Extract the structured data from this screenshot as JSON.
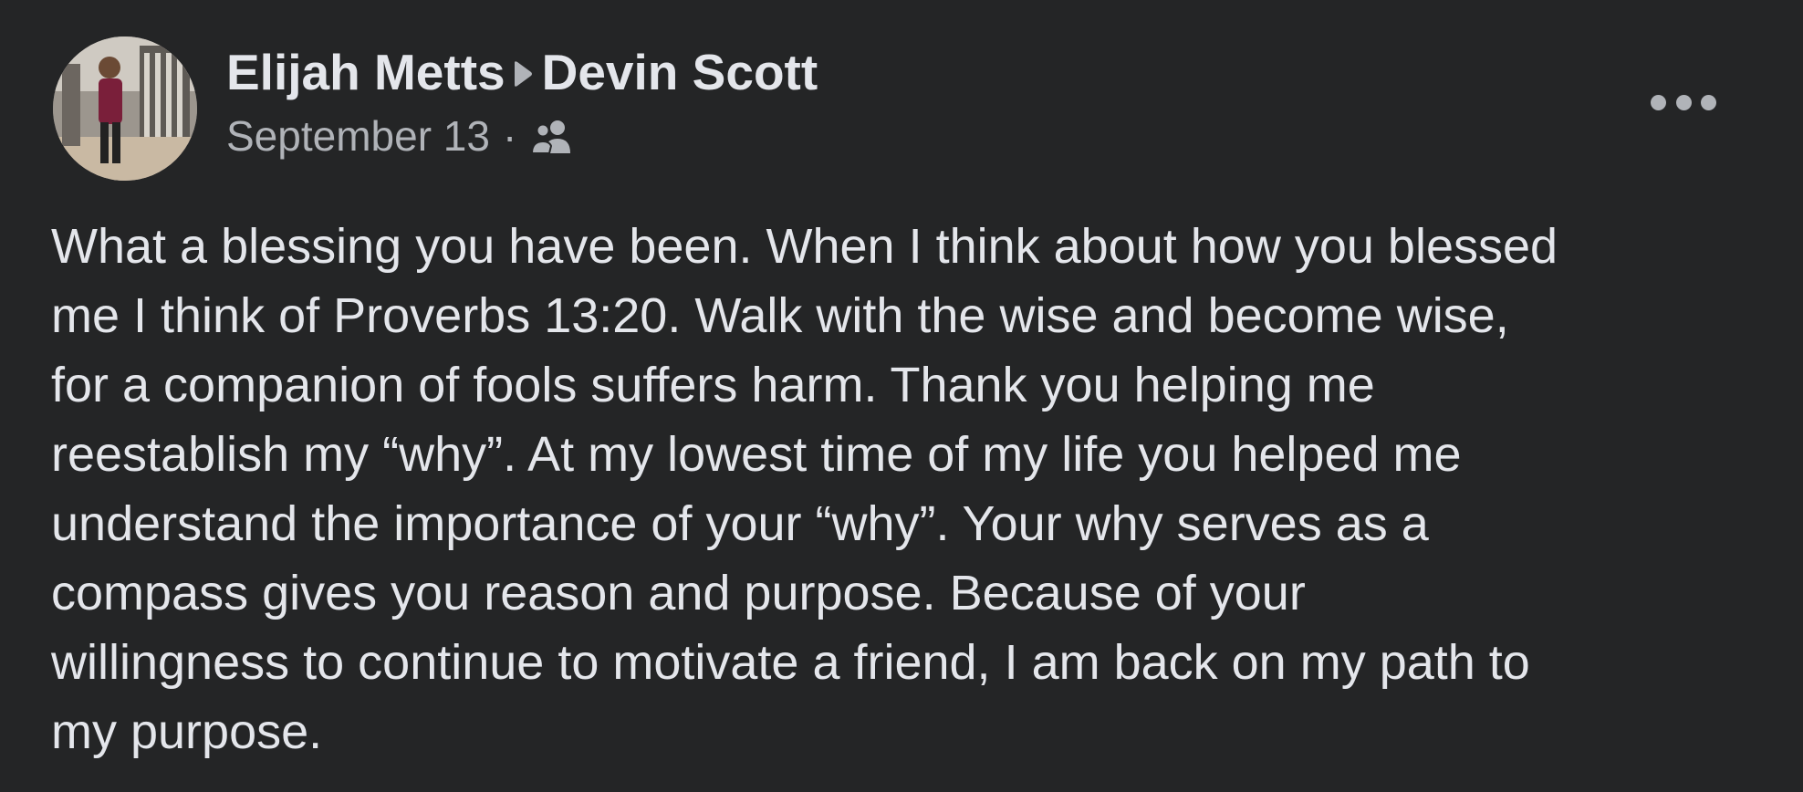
{
  "post": {
    "author": "Elijah Metts",
    "recipient": "Devin Scott",
    "date": "September 13",
    "separator": "·",
    "audience_icon": "friends-icon",
    "more_icon": "more-options-icon",
    "text": "What a blessing you have been. When I think about how you blessed\nme I think of Proverbs 13:20. Walk with the wise and become wise,\nfor a companion of fools suffers harm. Thank you helping me\nreestablish my “why”. At my lowest time of my life you helped me\nunderstand the importance of your “why”. Your why serves as a\ncompass gives you reason and purpose. Because of your\nwillingness to continue to motivate a friend, I am back on my path to\nmy purpose."
  },
  "colors": {
    "background": "#242526",
    "primary_text": "#e4e6eb",
    "secondary_text": "#b0b3b8"
  }
}
